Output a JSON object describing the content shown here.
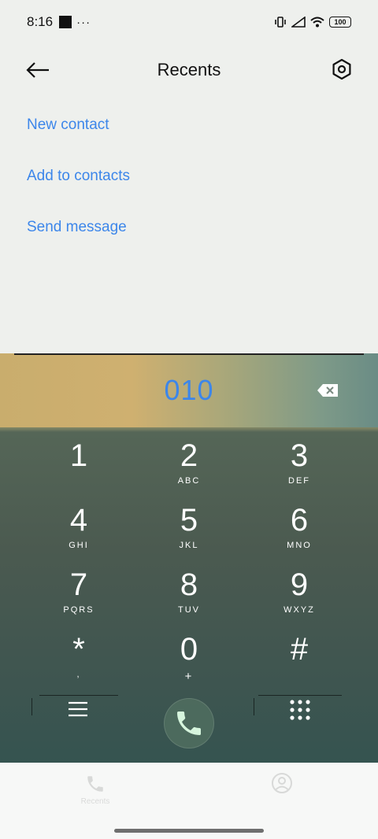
{
  "status": {
    "time": "8:16",
    "dots": "···",
    "battery": "100"
  },
  "header": {
    "title": "Recents"
  },
  "actions": [
    "New contact",
    "Add to contacts",
    "Send message"
  ],
  "dialer": {
    "number": "010",
    "keys": [
      {
        "digit": "1",
        "letters": ""
      },
      {
        "digit": "2",
        "letters": "ABC"
      },
      {
        "digit": "3",
        "letters": "DEF"
      },
      {
        "digit": "4",
        "letters": "GHI"
      },
      {
        "digit": "5",
        "letters": "JKL"
      },
      {
        "digit": "6",
        "letters": "MNO"
      },
      {
        "digit": "7",
        "letters": "PQRS"
      },
      {
        "digit": "8",
        "letters": "TUV"
      },
      {
        "digit": "9",
        "letters": "WXYZ"
      },
      {
        "digit": "*",
        "letters": ","
      },
      {
        "digit": "0",
        "letters": "+"
      },
      {
        "digit": "#",
        "letters": ""
      }
    ]
  },
  "tabs": {
    "recents_label": "Recents"
  },
  "colors": {
    "accent": "#3c86ea",
    "call_icon": "#d6f5dd"
  }
}
